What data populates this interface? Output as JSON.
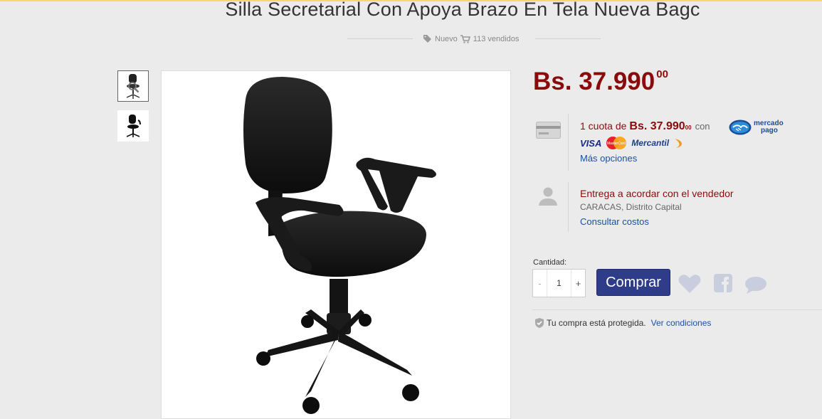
{
  "product": {
    "title": "Silla Secretarial Con Apoya Brazo En Tela Nueva Bagc",
    "condition": "Nuevo",
    "sold": "113 vendidos"
  },
  "gallery": {
    "thumbnails": [
      "chair-thumb-icon",
      "chair-thumb-icon"
    ],
    "selected_index": 0
  },
  "pricing": {
    "currency_amount": "Bs. 37.990",
    "cents": "00"
  },
  "payment": {
    "cuota_prefix": "1 cuota de",
    "cuota_amount": "Bs. 37.990",
    "cuota_cents": "00",
    "con": "con",
    "mercadopago_line1": "mercado",
    "mercadopago_line2": "pago",
    "card_visa": "VISA",
    "card_mastercard": "MasterCard",
    "card_mercantil": "Mercantil",
    "more_options": "Más opciones"
  },
  "shipping": {
    "entrega": "Entrega a acordar con el vendedor",
    "location": "CARACAS, Distrito Capital",
    "consult": "Consultar costos"
  },
  "purchase": {
    "qty_label": "Cantidad:",
    "minus": "-",
    "qty": "1",
    "plus": "+",
    "buy_label": "Comprar"
  },
  "protection": {
    "text": "Tu compra está protegida.",
    "link": "Ver condiciones"
  },
  "colors": {
    "price_red": "#8a0b0b",
    "buy_blue": "#2e3c8a",
    "link_blue": "#1a4fa3",
    "top_accent": "#f5d96b",
    "bg": "#ebebeb"
  }
}
